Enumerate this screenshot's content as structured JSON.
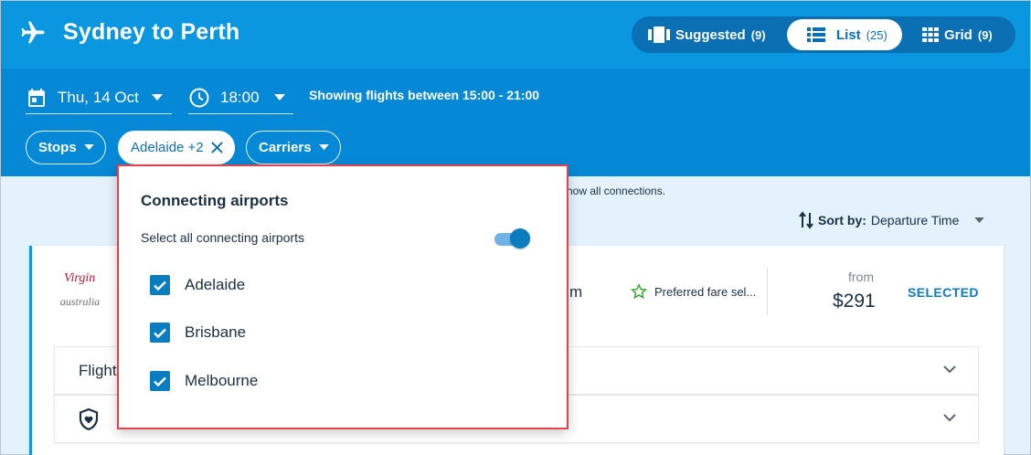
{
  "header": {
    "title": "Sydney to Perth",
    "views": [
      {
        "label": "Suggested",
        "count": "(9)"
      },
      {
        "label": "List",
        "count": "(25)"
      },
      {
        "label": "Grid",
        "count": "(9)"
      }
    ],
    "active_view": "List"
  },
  "toolbar": {
    "date": "Thu, 14 Oct",
    "time": "18:00",
    "showing": "Showing flights between 15:00 - 21:00",
    "filters": {
      "stops": "Stops",
      "airports": "Adelaide +2",
      "carriers": "Carriers"
    }
  },
  "content": {
    "info_fragment": "how all connections.",
    "sort_label": "Sort by:",
    "sort_value": "Departure Time"
  },
  "flight_card": {
    "airline_logo": "australia",
    "airline_logo_mark": "Virgin",
    "time_fragment": "m",
    "preferred_fare": "Preferred fare sel...",
    "from_label": "from",
    "price": "$291",
    "selected_label": "SELECTED",
    "sub_panel_1_text": "Flight"
  },
  "popup": {
    "title": "Connecting airports",
    "select_all_label": "Select all connecting airports",
    "select_all_on": true,
    "airports": [
      {
        "name": "Adelaide",
        "checked": true
      },
      {
        "name": "Brisbane",
        "checked": true
      },
      {
        "name": "Melbourne",
        "checked": true
      }
    ]
  },
  "colors": {
    "header_bg": "#0b96e0",
    "toolbar_bg": "#0589d6",
    "accent": "#0a7cc0",
    "popup_border": "#e0434b"
  }
}
